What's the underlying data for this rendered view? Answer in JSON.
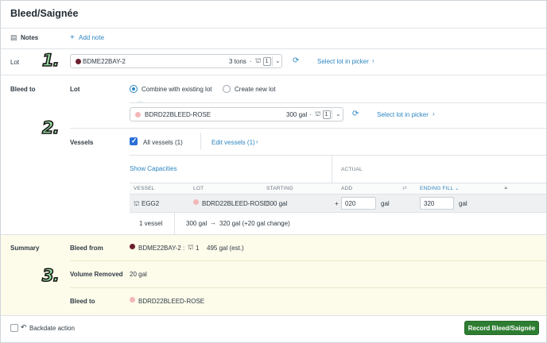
{
  "window": {
    "title": "Bleed/Saignée"
  },
  "notes": {
    "label": "Notes",
    "add_note": "Add note"
  },
  "lot_section": {
    "label": "Lot",
    "select": {
      "name": "BDME22BAY-2",
      "qty": "3 tons",
      "vessel_count": "1",
      "dot_color": "#6b1f2e"
    },
    "picker_link": "Select lot in picker",
    "badge": "1."
  },
  "bleed_to": {
    "label": "Bleed to",
    "lot_label": "Lot",
    "radio_combine": "Combine with existing lot",
    "radio_new": "Create new lot",
    "select": {
      "name": "BDRD22BLEED-ROSE",
      "qty": "300 gal",
      "vessel_count": "1",
      "dot_color": "#f3b7b8"
    },
    "picker_link": "Select lot in picker",
    "badge": "2."
  },
  "vessels": {
    "label": "Vessels",
    "all_vessels": "All vessels (1)",
    "edit_link": "Edit vessels (1)",
    "show_capacities": "Show Capacities",
    "actual_header": "ACTUAL",
    "columns": {
      "vessel": "VESSEL",
      "lot": "LOT",
      "starting": "STARTING",
      "add": "ADD",
      "swap": "⇄",
      "ending_fill": "ENDING FILL"
    },
    "rows": [
      {
        "vessel": "EGG2",
        "lot": "BDRD22BLEED-ROSE",
        "lot_dot": "#f3b7b8",
        "starting": "300 gal",
        "op": "+",
        "add": "020",
        "add_unit": "gal",
        "ending": "320",
        "ending_unit": "gal"
      }
    ],
    "footer": {
      "count": "1 vessel",
      "from": "300 gal",
      "arrow": "→",
      "change": "320 gal (+20 gal change)"
    }
  },
  "summary": {
    "label": "Summary",
    "badge": "3.",
    "bleed_from_label": "Bleed from",
    "bleed_from_lot": "BDME22BAY-2 :",
    "bleed_from_lot_dot": "#6b1f2e",
    "bleed_from_vessels": "1",
    "bleed_from_volume": "495 gal (est.)",
    "volume_removed_label": "Volume Removed",
    "volume_removed": "20 gal",
    "bleed_to_label": "Bleed to",
    "bleed_to_lot": "BDRD22BLEED-ROSE",
    "bleed_to_lot_dot": "#f3b7b8"
  },
  "footer": {
    "backdate": "Backdate action",
    "record_button": "Record Bleed/Saignée"
  },
  "colors": {
    "accent": "#2e86c1",
    "primary_button": "#2e7d32",
    "summary_bg": "#fdfbea",
    "badge": "#9be3a4"
  }
}
